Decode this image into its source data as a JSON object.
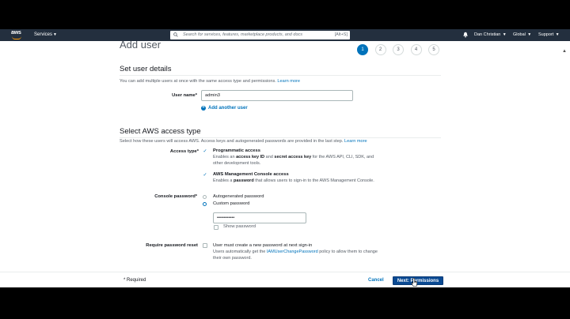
{
  "nav": {
    "logo": "aws",
    "services": "Services",
    "search_placeholder": "Search for services, features, marketplace products, and docs",
    "search_shortcut": "[Alt+S]",
    "user": "Dan Christian",
    "region": "Global",
    "support": "Support"
  },
  "page": {
    "title": "Add user",
    "steps": [
      "1",
      "2",
      "3",
      "4",
      "5"
    ],
    "active_step": "1"
  },
  "details": {
    "title": "Set user details",
    "desc": "You can add multiple users at once with the same access type and permissions.",
    "learn_more": "Learn more",
    "user_name_label": "User name*",
    "user_name_value": "admin3",
    "add_another": "Add another user"
  },
  "access": {
    "title": "Select AWS access type",
    "desc": "Select how these users will access AWS. Access keys and autogenerated passwords are provided in the last step.",
    "learn_more": "Learn more",
    "access_type_label": "Access type*",
    "programmatic": {
      "title": "Programmatic access",
      "desc_pre": "Enables an ",
      "desc_b1": "access key ID",
      "desc_mid": " and ",
      "desc_b2": "secret access key",
      "desc_post": " for the AWS API, CLI, SDK, and",
      "desc_line2": "other development tools."
    },
    "console": {
      "title": "AWS Management Console access",
      "desc_pre": "Enables a ",
      "desc_b": "password",
      "desc_post": " that allows users to sign-in to the AWS Management Console."
    },
    "console_password_label": "Console password*",
    "autogenerated": "Autogenerated password",
    "custom": "Custom password",
    "password_value": "•••••••••••",
    "show_password": "Show password",
    "require_reset_label": "Require password reset",
    "require_reset_title": "User must create a new password at next sign-in",
    "require_reset_desc_pre": "Users automatically get the ",
    "require_reset_link": "IAMUserChangePassword",
    "require_reset_desc_post": " policy to allow them to change",
    "require_reset_desc_line2": "their own password."
  },
  "footer": {
    "required": "* Required",
    "cancel": "Cancel",
    "next": "Next: Permissions"
  },
  "colors": {
    "nav_bg": "#232f3e",
    "accent": "#0073bb",
    "aws_orange": "#ff9900",
    "primary_button": "#0a4a93"
  }
}
